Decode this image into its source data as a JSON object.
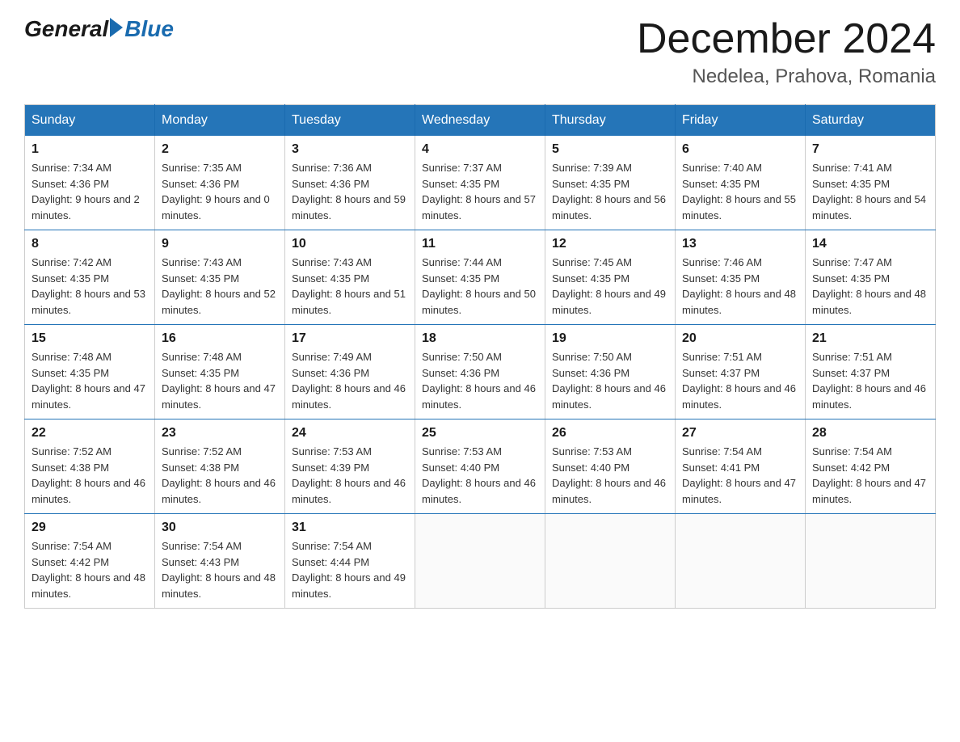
{
  "header": {
    "logo": {
      "general": "General",
      "blue": "Blue"
    },
    "title": "December 2024",
    "location": "Nedelea, Prahova, Romania"
  },
  "weekdays": [
    "Sunday",
    "Monday",
    "Tuesday",
    "Wednesday",
    "Thursday",
    "Friday",
    "Saturday"
  ],
  "weeks": [
    [
      {
        "day": "1",
        "sunrise": "7:34 AM",
        "sunset": "4:36 PM",
        "daylight": "9 hours and 2 minutes."
      },
      {
        "day": "2",
        "sunrise": "7:35 AM",
        "sunset": "4:36 PM",
        "daylight": "9 hours and 0 minutes."
      },
      {
        "day": "3",
        "sunrise": "7:36 AM",
        "sunset": "4:36 PM",
        "daylight": "8 hours and 59 minutes."
      },
      {
        "day": "4",
        "sunrise": "7:37 AM",
        "sunset": "4:35 PM",
        "daylight": "8 hours and 57 minutes."
      },
      {
        "day": "5",
        "sunrise": "7:39 AM",
        "sunset": "4:35 PM",
        "daylight": "8 hours and 56 minutes."
      },
      {
        "day": "6",
        "sunrise": "7:40 AM",
        "sunset": "4:35 PM",
        "daylight": "8 hours and 55 minutes."
      },
      {
        "day": "7",
        "sunrise": "7:41 AM",
        "sunset": "4:35 PM",
        "daylight": "8 hours and 54 minutes."
      }
    ],
    [
      {
        "day": "8",
        "sunrise": "7:42 AM",
        "sunset": "4:35 PM",
        "daylight": "8 hours and 53 minutes."
      },
      {
        "day": "9",
        "sunrise": "7:43 AM",
        "sunset": "4:35 PM",
        "daylight": "8 hours and 52 minutes."
      },
      {
        "day": "10",
        "sunrise": "7:43 AM",
        "sunset": "4:35 PM",
        "daylight": "8 hours and 51 minutes."
      },
      {
        "day": "11",
        "sunrise": "7:44 AM",
        "sunset": "4:35 PM",
        "daylight": "8 hours and 50 minutes."
      },
      {
        "day": "12",
        "sunrise": "7:45 AM",
        "sunset": "4:35 PM",
        "daylight": "8 hours and 49 minutes."
      },
      {
        "day": "13",
        "sunrise": "7:46 AM",
        "sunset": "4:35 PM",
        "daylight": "8 hours and 48 minutes."
      },
      {
        "day": "14",
        "sunrise": "7:47 AM",
        "sunset": "4:35 PM",
        "daylight": "8 hours and 48 minutes."
      }
    ],
    [
      {
        "day": "15",
        "sunrise": "7:48 AM",
        "sunset": "4:35 PM",
        "daylight": "8 hours and 47 minutes."
      },
      {
        "day": "16",
        "sunrise": "7:48 AM",
        "sunset": "4:35 PM",
        "daylight": "8 hours and 47 minutes."
      },
      {
        "day": "17",
        "sunrise": "7:49 AM",
        "sunset": "4:36 PM",
        "daylight": "8 hours and 46 minutes."
      },
      {
        "day": "18",
        "sunrise": "7:50 AM",
        "sunset": "4:36 PM",
        "daylight": "8 hours and 46 minutes."
      },
      {
        "day": "19",
        "sunrise": "7:50 AM",
        "sunset": "4:36 PM",
        "daylight": "8 hours and 46 minutes."
      },
      {
        "day": "20",
        "sunrise": "7:51 AM",
        "sunset": "4:37 PM",
        "daylight": "8 hours and 46 minutes."
      },
      {
        "day": "21",
        "sunrise": "7:51 AM",
        "sunset": "4:37 PM",
        "daylight": "8 hours and 46 minutes."
      }
    ],
    [
      {
        "day": "22",
        "sunrise": "7:52 AM",
        "sunset": "4:38 PM",
        "daylight": "8 hours and 46 minutes."
      },
      {
        "day": "23",
        "sunrise": "7:52 AM",
        "sunset": "4:38 PM",
        "daylight": "8 hours and 46 minutes."
      },
      {
        "day": "24",
        "sunrise": "7:53 AM",
        "sunset": "4:39 PM",
        "daylight": "8 hours and 46 minutes."
      },
      {
        "day": "25",
        "sunrise": "7:53 AM",
        "sunset": "4:40 PM",
        "daylight": "8 hours and 46 minutes."
      },
      {
        "day": "26",
        "sunrise": "7:53 AM",
        "sunset": "4:40 PM",
        "daylight": "8 hours and 46 minutes."
      },
      {
        "day": "27",
        "sunrise": "7:54 AM",
        "sunset": "4:41 PM",
        "daylight": "8 hours and 47 minutes."
      },
      {
        "day": "28",
        "sunrise": "7:54 AM",
        "sunset": "4:42 PM",
        "daylight": "8 hours and 47 minutes."
      }
    ],
    [
      {
        "day": "29",
        "sunrise": "7:54 AM",
        "sunset": "4:42 PM",
        "daylight": "8 hours and 48 minutes."
      },
      {
        "day": "30",
        "sunrise": "7:54 AM",
        "sunset": "4:43 PM",
        "daylight": "8 hours and 48 minutes."
      },
      {
        "day": "31",
        "sunrise": "7:54 AM",
        "sunset": "4:44 PM",
        "daylight": "8 hours and 49 minutes."
      },
      null,
      null,
      null,
      null
    ]
  ]
}
